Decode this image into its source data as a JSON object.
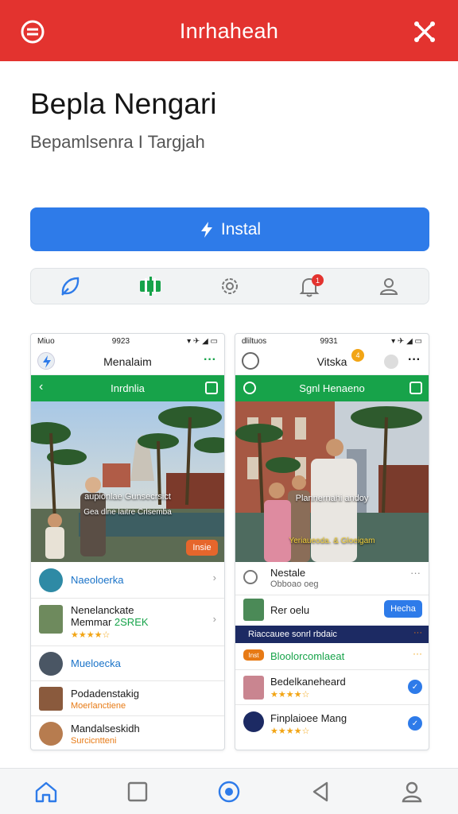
{
  "topbar": {
    "title": "Inrhaheah"
  },
  "app": {
    "name": "Bepla Nengari",
    "subtitle": "Bepamlsenra I Targjah",
    "install_label": "Instal"
  },
  "icon_bar": {
    "notification_count": "1"
  },
  "screens": [
    {
      "time": "9923",
      "carrier": "Miuo",
      "header_title": "Menalaim",
      "green_title": "Inrdnlia",
      "caption1": "aupionlae Gunsecrsict",
      "caption2": "Gea dlne laitre Crlsemba",
      "chip": "Insie",
      "items": [
        {
          "title": "Naeoloerka"
        },
        {
          "title": "Nenelanckate",
          "subtitle": "Memmar",
          "tag": "2SREK",
          "rating": "★★★★☆"
        },
        {
          "title": "Mueloecka"
        },
        {
          "title": "Podadenstakig",
          "subtitle": "Moerlanctiene"
        },
        {
          "title": "Mandalseskidh",
          "subtitle": "Surcicntteni"
        }
      ]
    },
    {
      "time": "9931",
      "carrier": "dliltuos",
      "header_title": "Vitska",
      "header_badge": "4",
      "green_title": "Sgnl Henaeno",
      "caption1": "Plannernahi andoy",
      "caption2": "Yeriaueoda. & Gloeigam",
      "items": [
        {
          "title": "Nestale",
          "subtitle": "Obboao oeg"
        },
        {
          "title": "Rer oelu",
          "button": "Hecha"
        },
        {
          "title": "Riaccauee sonrl rbdaic"
        },
        {
          "title": "Bloolorcomlaeat",
          "tag": "Inst"
        },
        {
          "title": "Bedelkaneheard",
          "rating": "★★★★☆"
        },
        {
          "title": "Finplaioee Mang",
          "rating": "★★★★☆"
        }
      ]
    }
  ],
  "colors": {
    "brand": "#e3332f",
    "accent": "#2e7be9",
    "green": "#17a34a"
  }
}
